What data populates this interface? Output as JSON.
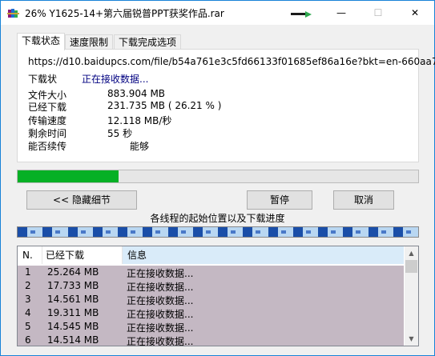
{
  "window": {
    "title": "26% Y1625-14+第六届锐普PPT获奖作品.rar",
    "app_icon": "winrar-books-icon",
    "controls": {
      "minimize": "—",
      "maximize": "☐",
      "close": "✕"
    }
  },
  "tabs": [
    {
      "label": "下载状态",
      "active": true
    },
    {
      "label": "速度限制",
      "active": false
    },
    {
      "label": "下载完成选项",
      "active": false
    }
  ],
  "status": {
    "url": "https://d10.baidupcs.com/file/b54a761e3c5fd66133f01685ef86a16e?bkt=en-660aa7",
    "state_label": "下载状",
    "state_value": "正在接收数据...",
    "file_size_label": "文件大小",
    "file_size_value": "883.904  MB",
    "downloaded_label": "已经下载",
    "downloaded_value": "231.735  MB  ( 26.21 % )",
    "speed_label": "传输速度",
    "speed_value": "12.118  MB/秒",
    "remaining_label": "剩余时间",
    "remaining_value": "55 秒",
    "resume_label": "能否续传",
    "resume_value": "能够"
  },
  "progress": {
    "fraction": 0.2621,
    "color": "#06b025"
  },
  "buttons": {
    "hide_details": "<< 隐藏细节",
    "pause": "暂停",
    "cancel": "取消"
  },
  "threads": {
    "caption": "各线程的起始位置以及下载进度",
    "segments": [
      0.0,
      0.0625,
      0.125,
      0.1875,
      0.25,
      0.3125,
      0.375,
      0.4375,
      0.5,
      0.5625,
      0.625,
      0.6875,
      0.75,
      0.8125,
      0.875,
      0.9375
    ]
  },
  "list": {
    "columns": [
      "N.",
      "已经下载",
      "信息"
    ],
    "rows": [
      {
        "n": "1",
        "downloaded": "25.264 MB",
        "info": "正在接收数据..."
      },
      {
        "n": "2",
        "downloaded": "17.733 MB",
        "info": "正在接收数据..."
      },
      {
        "n": "3",
        "downloaded": "14.561 MB",
        "info": "正在接收数据..."
      },
      {
        "n": "4",
        "downloaded": "19.311 MB",
        "info": "正在接收数据..."
      },
      {
        "n": "5",
        "downloaded": "14.545 MB",
        "info": "正在接收数据..."
      },
      {
        "n": "6",
        "downloaded": "14.514 MB",
        "info": "正在接收数据..."
      }
    ]
  },
  "colors": {
    "row_bg": "#c4b8c3",
    "link": "#000080",
    "accent": "#1883d7"
  }
}
